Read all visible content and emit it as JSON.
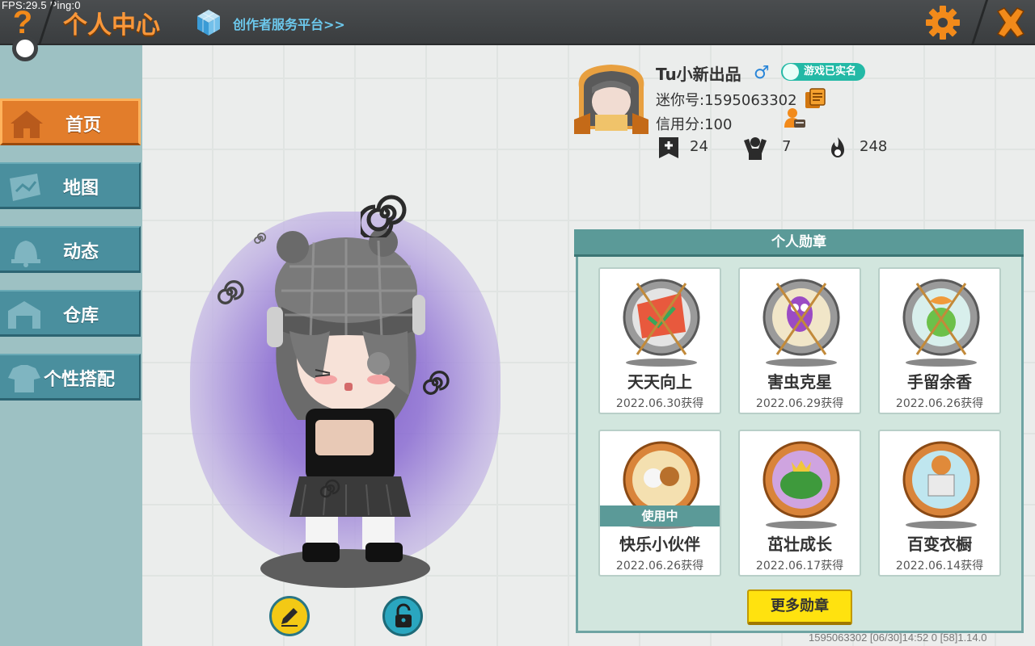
{
  "topbar": {
    "fps": "FPS:29.5  Ping:0",
    "help_glyph": "?",
    "title": "个人中心",
    "creator_link": "创作者服务平台>>",
    "icons": {
      "help": "question-icon",
      "creator": "cube-icon",
      "settings": "gear-icon",
      "close": "close-icon"
    },
    "accent_color": "#f28a1a"
  },
  "sidebar": {
    "items": [
      {
        "label": "首页",
        "icon": "home-icon",
        "active": true
      },
      {
        "label": "地图",
        "icon": "map-icon",
        "active": false
      },
      {
        "label": "动态",
        "icon": "bell-icon",
        "active": false
      },
      {
        "label": "仓库",
        "icon": "warehouse-icon",
        "active": false
      },
      {
        "label": "个性搭配",
        "icon": "outfit-icon",
        "active": false
      }
    ]
  },
  "profile": {
    "username": "Tu小新出品",
    "gender": "♂",
    "verified_label": "游戏已实名",
    "mini_id": "迷你号:1595063302",
    "credit": "信用分:100",
    "stats": [
      {
        "icon": "friends-add-icon",
        "value": "24"
      },
      {
        "icon": "fans-icon",
        "value": "7"
      },
      {
        "icon": "popularity-flame-icon",
        "value": "248"
      }
    ]
  },
  "badges": {
    "title": "个人勋章",
    "items": [
      {
        "name": "天天向上",
        "date": "2022.06.30获得",
        "in_use": false
      },
      {
        "name": "害虫克星",
        "date": "2022.06.29获得",
        "in_use": false
      },
      {
        "name": "手留余香",
        "date": "2022.06.26获得",
        "in_use": false
      },
      {
        "name": "快乐小伙伴",
        "date": "2022.06.26获得",
        "in_use": true,
        "in_use_label": "使用中"
      },
      {
        "name": "茁壮成长",
        "date": "2022.06.17获得",
        "in_use": false
      },
      {
        "name": "百变衣橱",
        "date": "2022.06.14获得",
        "in_use": false
      }
    ],
    "more_label": "更多勋章"
  },
  "avatar_controls": {
    "edit_icon": "pencil-icon",
    "lock_icon": "lock-icon"
  },
  "footer": "1595063302   [06/30]14:52 0  [58]1.14.0"
}
